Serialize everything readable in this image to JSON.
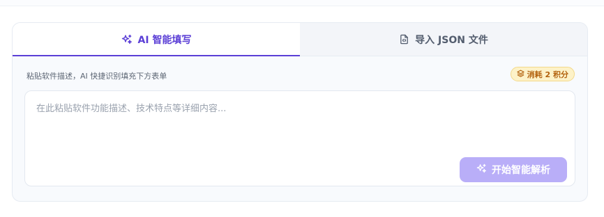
{
  "tabs": [
    {
      "label": "AI 智能填写",
      "icon": "sparkles-icon",
      "active": true
    },
    {
      "label": "导入 JSON 文件",
      "icon": "file-code-icon",
      "active": false
    }
  ],
  "hint_text": "粘贴软件描述，AI 快捷识别填充下方表单",
  "cost_badge": {
    "label": "消耗 2 积分",
    "icon": "layers-icon"
  },
  "textarea": {
    "placeholder": "在此粘贴软件功能描述、技术特点等详细内容...",
    "value": ""
  },
  "parse_button": {
    "label": "开始智能解析",
    "icon": "sparkles-icon"
  },
  "colors": {
    "accent": "#5b3fd6",
    "button_disabled": "#b9aef8",
    "badge_bg": "#fdf2c8",
    "badge_text": "#b2610d"
  }
}
